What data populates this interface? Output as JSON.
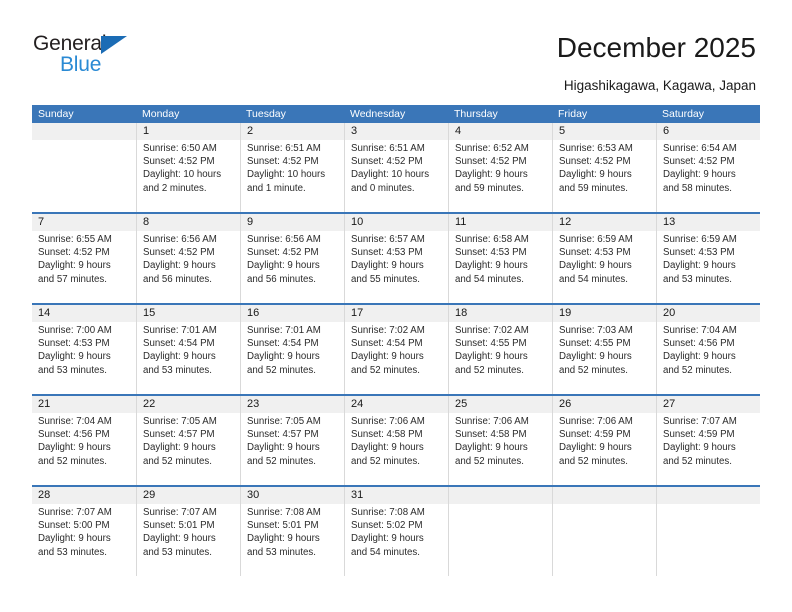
{
  "logo": {
    "word1": "General",
    "word2": "Blue",
    "triangle_color": "#1b6cb5",
    "word2_color": "#2a8ad4"
  },
  "header": {
    "title": "December 2025",
    "subtitle": "Higashikagawa, Kagawa, Japan"
  },
  "theme": {
    "header_blue": "#3a76b8",
    "number_band": "#f0f0f0",
    "divider": "#d9d9d9"
  },
  "calendar": {
    "weekday_headers": [
      "Sunday",
      "Monday",
      "Tuesday",
      "Wednesday",
      "Thursday",
      "Friday",
      "Saturday"
    ],
    "weeks": [
      [
        {
          "day": "",
          "sunrise": "",
          "sunset": "",
          "daylight1": "",
          "daylight2": ""
        },
        {
          "day": "1",
          "sunrise": "Sunrise: 6:50 AM",
          "sunset": "Sunset: 4:52 PM",
          "daylight1": "Daylight: 10 hours",
          "daylight2": "and 2 minutes."
        },
        {
          "day": "2",
          "sunrise": "Sunrise: 6:51 AM",
          "sunset": "Sunset: 4:52 PM",
          "daylight1": "Daylight: 10 hours",
          "daylight2": "and 1 minute."
        },
        {
          "day": "3",
          "sunrise": "Sunrise: 6:51 AM",
          "sunset": "Sunset: 4:52 PM",
          "daylight1": "Daylight: 10 hours",
          "daylight2": "and 0 minutes."
        },
        {
          "day": "4",
          "sunrise": "Sunrise: 6:52 AM",
          "sunset": "Sunset: 4:52 PM",
          "daylight1": "Daylight: 9 hours",
          "daylight2": "and 59 minutes."
        },
        {
          "day": "5",
          "sunrise": "Sunrise: 6:53 AM",
          "sunset": "Sunset: 4:52 PM",
          "daylight1": "Daylight: 9 hours",
          "daylight2": "and 59 minutes."
        },
        {
          "day": "6",
          "sunrise": "Sunrise: 6:54 AM",
          "sunset": "Sunset: 4:52 PM",
          "daylight1": "Daylight: 9 hours",
          "daylight2": "and 58 minutes."
        }
      ],
      [
        {
          "day": "7",
          "sunrise": "Sunrise: 6:55 AM",
          "sunset": "Sunset: 4:52 PM",
          "daylight1": "Daylight: 9 hours",
          "daylight2": "and 57 minutes."
        },
        {
          "day": "8",
          "sunrise": "Sunrise: 6:56 AM",
          "sunset": "Sunset: 4:52 PM",
          "daylight1": "Daylight: 9 hours",
          "daylight2": "and 56 minutes."
        },
        {
          "day": "9",
          "sunrise": "Sunrise: 6:56 AM",
          "sunset": "Sunset: 4:52 PM",
          "daylight1": "Daylight: 9 hours",
          "daylight2": "and 56 minutes."
        },
        {
          "day": "10",
          "sunrise": "Sunrise: 6:57 AM",
          "sunset": "Sunset: 4:53 PM",
          "daylight1": "Daylight: 9 hours",
          "daylight2": "and 55 minutes."
        },
        {
          "day": "11",
          "sunrise": "Sunrise: 6:58 AM",
          "sunset": "Sunset: 4:53 PM",
          "daylight1": "Daylight: 9 hours",
          "daylight2": "and 54 minutes."
        },
        {
          "day": "12",
          "sunrise": "Sunrise: 6:59 AM",
          "sunset": "Sunset: 4:53 PM",
          "daylight1": "Daylight: 9 hours",
          "daylight2": "and 54 minutes."
        },
        {
          "day": "13",
          "sunrise": "Sunrise: 6:59 AM",
          "sunset": "Sunset: 4:53 PM",
          "daylight1": "Daylight: 9 hours",
          "daylight2": "and 53 minutes."
        }
      ],
      [
        {
          "day": "14",
          "sunrise": "Sunrise: 7:00 AM",
          "sunset": "Sunset: 4:53 PM",
          "daylight1": "Daylight: 9 hours",
          "daylight2": "and 53 minutes."
        },
        {
          "day": "15",
          "sunrise": "Sunrise: 7:01 AM",
          "sunset": "Sunset: 4:54 PM",
          "daylight1": "Daylight: 9 hours",
          "daylight2": "and 53 minutes."
        },
        {
          "day": "16",
          "sunrise": "Sunrise: 7:01 AM",
          "sunset": "Sunset: 4:54 PM",
          "daylight1": "Daylight: 9 hours",
          "daylight2": "and 52 minutes."
        },
        {
          "day": "17",
          "sunrise": "Sunrise: 7:02 AM",
          "sunset": "Sunset: 4:54 PM",
          "daylight1": "Daylight: 9 hours",
          "daylight2": "and 52 minutes."
        },
        {
          "day": "18",
          "sunrise": "Sunrise: 7:02 AM",
          "sunset": "Sunset: 4:55 PM",
          "daylight1": "Daylight: 9 hours",
          "daylight2": "and 52 minutes."
        },
        {
          "day": "19",
          "sunrise": "Sunrise: 7:03 AM",
          "sunset": "Sunset: 4:55 PM",
          "daylight1": "Daylight: 9 hours",
          "daylight2": "and 52 minutes."
        },
        {
          "day": "20",
          "sunrise": "Sunrise: 7:04 AM",
          "sunset": "Sunset: 4:56 PM",
          "daylight1": "Daylight: 9 hours",
          "daylight2": "and 52 minutes."
        }
      ],
      [
        {
          "day": "21",
          "sunrise": "Sunrise: 7:04 AM",
          "sunset": "Sunset: 4:56 PM",
          "daylight1": "Daylight: 9 hours",
          "daylight2": "and 52 minutes."
        },
        {
          "day": "22",
          "sunrise": "Sunrise: 7:05 AM",
          "sunset": "Sunset: 4:57 PM",
          "daylight1": "Daylight: 9 hours",
          "daylight2": "and 52 minutes."
        },
        {
          "day": "23",
          "sunrise": "Sunrise: 7:05 AM",
          "sunset": "Sunset: 4:57 PM",
          "daylight1": "Daylight: 9 hours",
          "daylight2": "and 52 minutes."
        },
        {
          "day": "24",
          "sunrise": "Sunrise: 7:06 AM",
          "sunset": "Sunset: 4:58 PM",
          "daylight1": "Daylight: 9 hours",
          "daylight2": "and 52 minutes."
        },
        {
          "day": "25",
          "sunrise": "Sunrise: 7:06 AM",
          "sunset": "Sunset: 4:58 PM",
          "daylight1": "Daylight: 9 hours",
          "daylight2": "and 52 minutes."
        },
        {
          "day": "26",
          "sunrise": "Sunrise: 7:06 AM",
          "sunset": "Sunset: 4:59 PM",
          "daylight1": "Daylight: 9 hours",
          "daylight2": "and 52 minutes."
        },
        {
          "day": "27",
          "sunrise": "Sunrise: 7:07 AM",
          "sunset": "Sunset: 4:59 PM",
          "daylight1": "Daylight: 9 hours",
          "daylight2": "and 52 minutes."
        }
      ],
      [
        {
          "day": "28",
          "sunrise": "Sunrise: 7:07 AM",
          "sunset": "Sunset: 5:00 PM",
          "daylight1": "Daylight: 9 hours",
          "daylight2": "and 53 minutes."
        },
        {
          "day": "29",
          "sunrise": "Sunrise: 7:07 AM",
          "sunset": "Sunset: 5:01 PM",
          "daylight1": "Daylight: 9 hours",
          "daylight2": "and 53 minutes."
        },
        {
          "day": "30",
          "sunrise": "Sunrise: 7:08 AM",
          "sunset": "Sunset: 5:01 PM",
          "daylight1": "Daylight: 9 hours",
          "daylight2": "and 53 minutes."
        },
        {
          "day": "31",
          "sunrise": "Sunrise: 7:08 AM",
          "sunset": "Sunset: 5:02 PM",
          "daylight1": "Daylight: 9 hours",
          "daylight2": "and 54 minutes."
        },
        {
          "day": "",
          "sunrise": "",
          "sunset": "",
          "daylight1": "",
          "daylight2": ""
        },
        {
          "day": "",
          "sunrise": "",
          "sunset": "",
          "daylight1": "",
          "daylight2": ""
        },
        {
          "day": "",
          "sunrise": "",
          "sunset": "",
          "daylight1": "",
          "daylight2": ""
        }
      ]
    ]
  }
}
